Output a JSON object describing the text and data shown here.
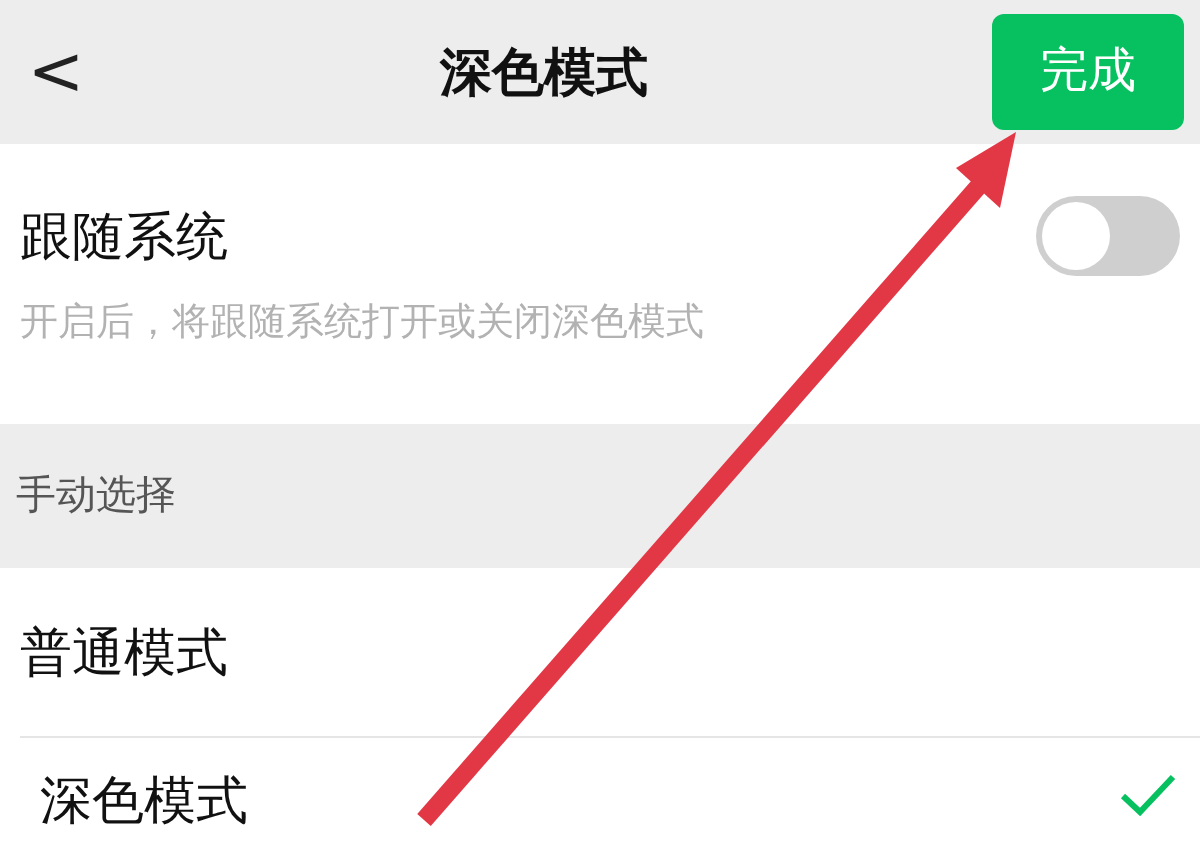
{
  "header": {
    "back": "<",
    "title": "深色模式",
    "done_button": "完成"
  },
  "follow_system": {
    "label": "跟随系统",
    "on": false,
    "description": "开启后，将跟随系统打开或关闭深色模式"
  },
  "manual_section": {
    "title": "手动选择"
  },
  "modes": [
    {
      "label": "普通模式",
      "selected": false
    },
    {
      "label": "深色模式",
      "selected": true
    }
  ]
}
